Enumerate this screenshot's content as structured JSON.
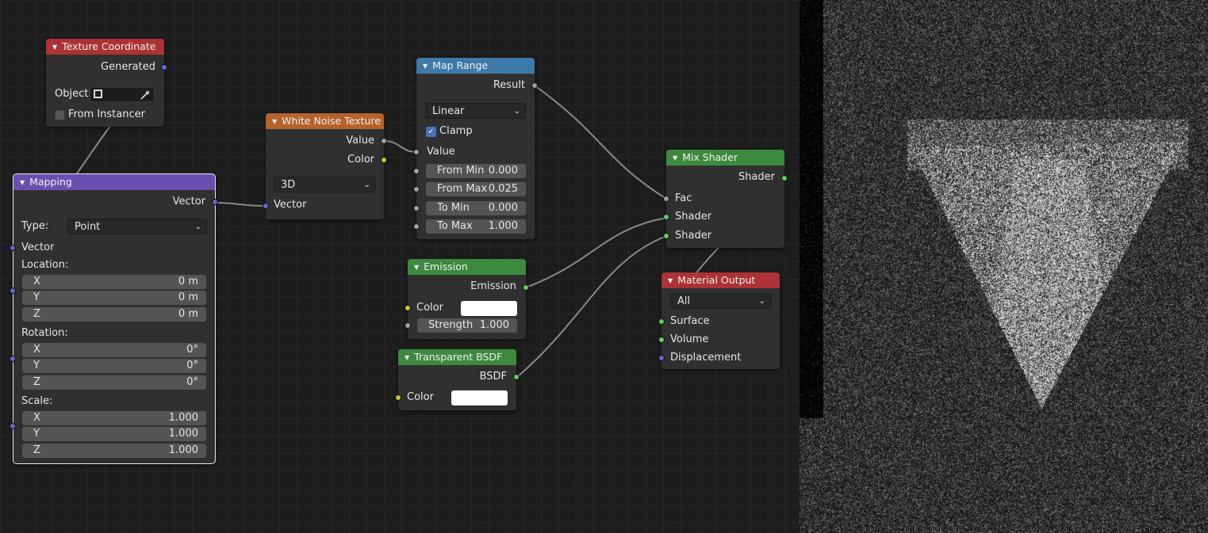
{
  "nodes": {
    "texture_coordinate": {
      "title": "Texture Coordinate",
      "generated": "Generated",
      "object_label": "Object:",
      "from_instancer": "From Instancer"
    },
    "mapping": {
      "title": "Mapping",
      "vector_out": "Vector",
      "type_label": "Type:",
      "type_value": "Point",
      "vector_in": "Vector",
      "location_label": "Location:",
      "rotation_label": "Rotation:",
      "scale_label": "Scale:",
      "location": [
        {
          "axis": "X",
          "value": "0 m"
        },
        {
          "axis": "Y",
          "value": "0 m"
        },
        {
          "axis": "Z",
          "value": "0 m"
        }
      ],
      "rotation": [
        {
          "axis": "X",
          "value": "0°"
        },
        {
          "axis": "Y",
          "value": "0°"
        },
        {
          "axis": "Z",
          "value": "0°"
        }
      ],
      "scale": [
        {
          "axis": "X",
          "value": "1.000"
        },
        {
          "axis": "Y",
          "value": "1.000"
        },
        {
          "axis": "Z",
          "value": "1.000"
        }
      ]
    },
    "white_noise": {
      "title": "White Noise Texture",
      "value_out": "Value",
      "color_out": "Color",
      "dimensions": "3D",
      "vector_in": "Vector"
    },
    "map_range": {
      "title": "Map Range",
      "result": "Result",
      "interpolation": "Linear",
      "clamp": "Clamp",
      "value_in": "Value",
      "fields": [
        {
          "label": "From Min",
          "value": "0.000"
        },
        {
          "label": "From Max",
          "value": "0.025"
        },
        {
          "label": "To Min",
          "value": "0.000"
        },
        {
          "label": "To Max",
          "value": "1.000"
        }
      ]
    },
    "emission": {
      "title": "Emission",
      "emission_out": "Emission",
      "color_label": "Color",
      "strength_label": "Strength",
      "strength_value": "1.000"
    },
    "transparent_bsdf": {
      "title": "Transparent BSDF",
      "bsdf_out": "BSDF",
      "color_label": "Color"
    },
    "mix_shader": {
      "title": "Mix Shader",
      "shader_out": "Shader",
      "fac": "Fac",
      "shader_in_1": "Shader",
      "shader_in_2": "Shader"
    },
    "material_output": {
      "title": "Material Output",
      "target": "All",
      "surface": "Surface",
      "volume": "Volume",
      "displacement": "Displacement"
    }
  },
  "icons": {
    "collapse": "collapse-triangle-icon",
    "eyedropper": "eyedropper-icon",
    "object": "object-icon",
    "dropdown": "chevron-down-icon",
    "check": "checkmark-icon"
  },
  "colors": {
    "texture_header": "#ab3235",
    "vector_header": "#6b4fb0",
    "texture_node_header": "#b5622b",
    "converter_header": "#3e7aa8",
    "shader_header": "#3d8a3f",
    "output_header": "#ab3235"
  }
}
